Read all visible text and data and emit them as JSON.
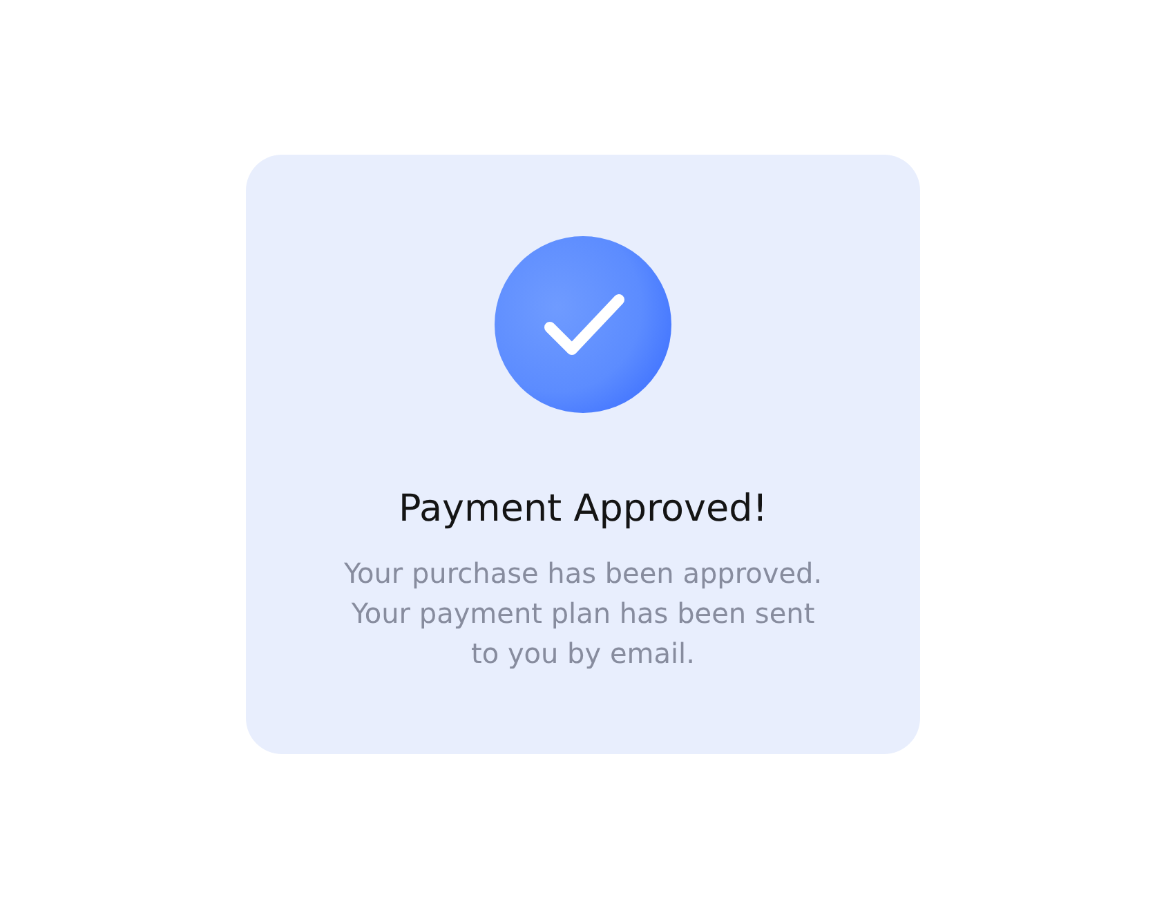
{
  "dialog": {
    "title": "Payment Approved!",
    "message": "Your purchase has been approved.\nYour payment plan has been sent\nto you by email."
  }
}
